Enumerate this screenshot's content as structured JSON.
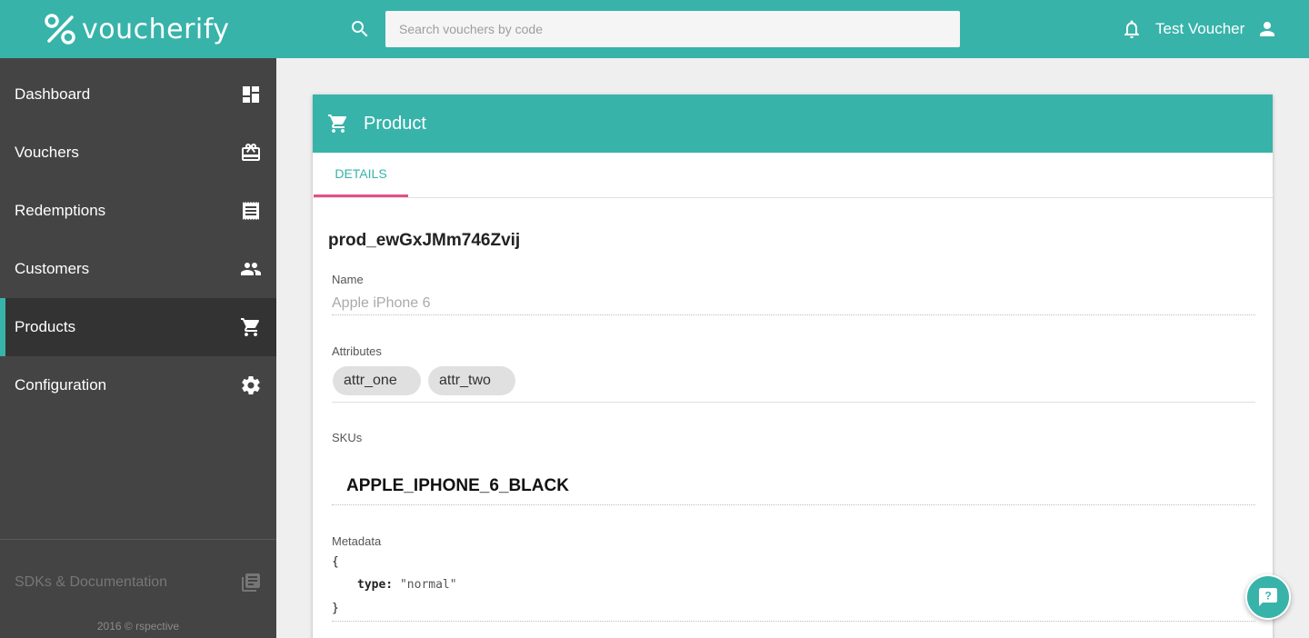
{
  "brand": {
    "logo_text": "voucherify",
    "accent": "#37b3aa",
    "highlight": "#e64f8a"
  },
  "search": {
    "placeholder": "Search vouchers by code",
    "value": "",
    "icon": "search-icon"
  },
  "header": {
    "user_name": "Test Voucher",
    "bell_icon": "bell-icon",
    "user_icon": "person-icon"
  },
  "sidebar": {
    "items": [
      {
        "label": "Dashboard",
        "icon": "dashboard-icon"
      },
      {
        "label": "Vouchers",
        "icon": "gift-card-icon"
      },
      {
        "label": "Redemptions",
        "icon": "receipt-icon"
      },
      {
        "label": "Customers",
        "icon": "people-icon"
      },
      {
        "label": "Products",
        "icon": "cart-icon",
        "active": true
      },
      {
        "label": "Configuration",
        "icon": "gear-icon"
      }
    ],
    "sdk_label": "SDKs & Documentation",
    "copyright": "2016 © rspective"
  },
  "card": {
    "title": "Product",
    "tab": "DETAILS",
    "product_id": "prod_ewGxJMm746Zvij",
    "name_label": "Name",
    "name_value": "Apple iPhone 6",
    "attributes_label": "Attributes",
    "attributes": [
      "attr_one",
      "attr_two"
    ],
    "skus_label": "SKUs",
    "sku": "APPLE_IPHONE_6_BLACK",
    "metadata_label": "Metadata",
    "metadata": {
      "open": "{",
      "key": "type:",
      "value": "\"normal\"",
      "close": "}"
    }
  }
}
